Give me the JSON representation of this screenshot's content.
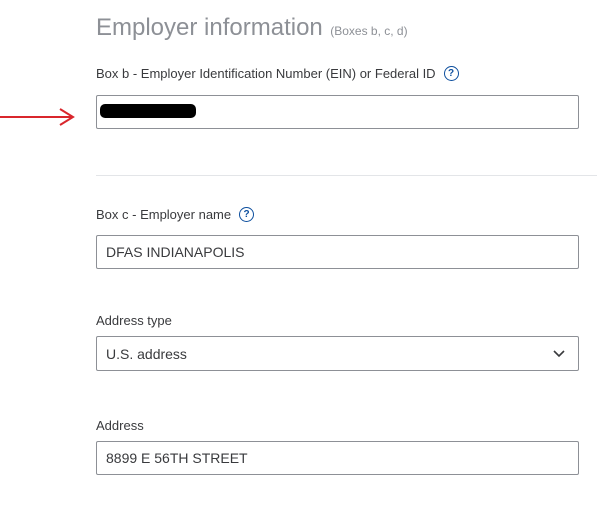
{
  "section": {
    "title": "Employer information",
    "subtitle": "(Boxes b, c, d)"
  },
  "fields": {
    "ein": {
      "label": "Box b - Employer Identification Number (EIN) or Federal ID",
      "help_icon": "question-mark-circle-icon",
      "value_redacted": true
    },
    "employer_name": {
      "label": "Box c - Employer name",
      "help_icon": "question-mark-circle-icon",
      "value": "DFAS INDIANAPOLIS"
    },
    "address_type": {
      "label": "Address type",
      "selected": "U.S. address",
      "icon": "chevron-down-icon"
    },
    "address": {
      "label": "Address",
      "value": "8899 E 56TH STREET"
    }
  },
  "annotation": {
    "icon": "red-arrow-icon",
    "color": "#d9262c"
  },
  "colors": {
    "help_icon": "#0d4f9e",
    "title_gray": "#8d9096",
    "input_border": "#8d9096"
  }
}
